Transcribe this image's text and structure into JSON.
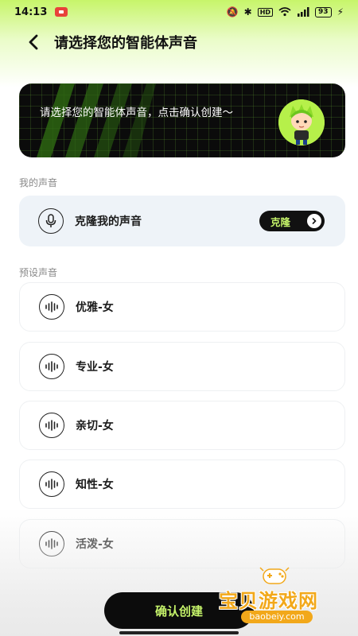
{
  "status_bar": {
    "time": "14:13",
    "battery": "93",
    "network": "HD"
  },
  "header": {
    "title": "请选择您的智能体声音"
  },
  "banner": {
    "text": "请选择您的智能体声音，点击确认创建～"
  },
  "my_voice": {
    "section_label": "我的声音",
    "clone_label": "克隆我的声音",
    "clone_button": "克隆"
  },
  "preset_voice": {
    "section_label": "预设声音",
    "items": [
      {
        "label": "优雅-女"
      },
      {
        "label": "专业-女"
      },
      {
        "label": "亲切-女"
      },
      {
        "label": "知性-女"
      },
      {
        "label": "活泼-女"
      }
    ]
  },
  "confirm_button": "确认创建",
  "watermark": {
    "text": "宝贝游戏网",
    "url": "baobeiy.com"
  },
  "colors": {
    "accent_green": "#c5f36a",
    "dark": "#0c0c0c",
    "card_bg": "#eef3f8"
  }
}
